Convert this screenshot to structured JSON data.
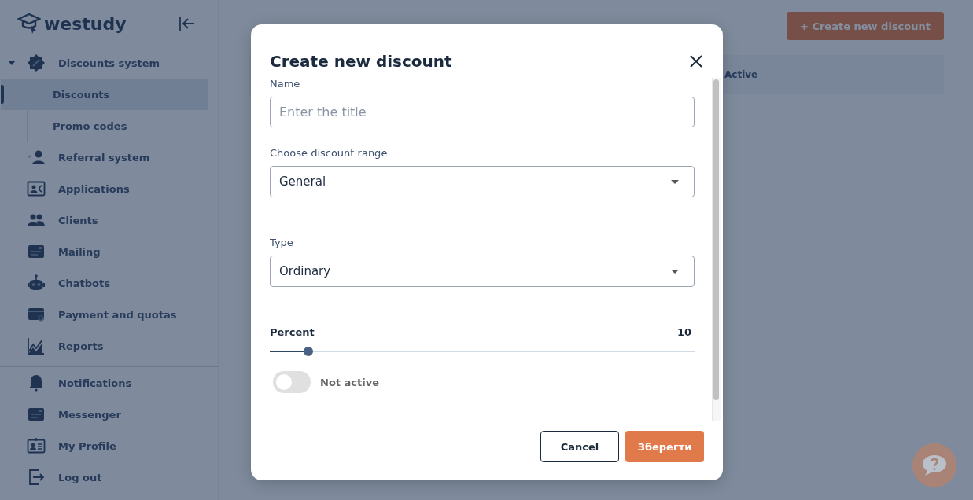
{
  "sidebar": {
    "logo": "westudy",
    "items": [
      {
        "label": "Discounts system",
        "expanded": true,
        "selected": false,
        "children": [
          {
            "label": "Discounts",
            "selected": true
          },
          {
            "label": "Promo codes",
            "selected": false
          }
        ]
      },
      {
        "label": "Referral system",
        "selected": false
      },
      {
        "label": "Applications",
        "selected": false
      },
      {
        "label": "Clients",
        "selected": false
      },
      {
        "label": "Mailing",
        "selected": false
      },
      {
        "label": "Chatbots",
        "selected": false
      },
      {
        "label": "Payment and quotas",
        "selected": false
      },
      {
        "label": "Reports",
        "selected": false
      }
    ],
    "bottom_items": [
      {
        "label": "Notifications",
        "selected": false
      },
      {
        "label": "Messenger",
        "selected": false
      },
      {
        "label": "My Profile",
        "selected": false
      },
      {
        "label": "Log out",
        "selected": false
      }
    ]
  },
  "page": {
    "create_button": "+ Create new discount",
    "table": {
      "columns": [
        "Active"
      ]
    }
  },
  "dialog": {
    "title": "Create new discount",
    "fields": [
      {
        "kind": "text",
        "label": "Name",
        "placeholder": "Enter the title"
      },
      {
        "kind": "select",
        "label": "Choose discount range",
        "value": "General"
      },
      {
        "kind": "select",
        "label": "Type",
        "value": "Ordinary"
      },
      {
        "kind": "slider",
        "label": "Percent",
        "reading": "10",
        "level": 0.09
      },
      {
        "kind": "toggle",
        "label": "Not active",
        "on": false
      }
    ],
    "buttons": [
      {
        "label": "Cancel",
        "kind": "secondary"
      },
      {
        "label": "Зберегти",
        "kind": "primary"
      }
    ]
  }
}
